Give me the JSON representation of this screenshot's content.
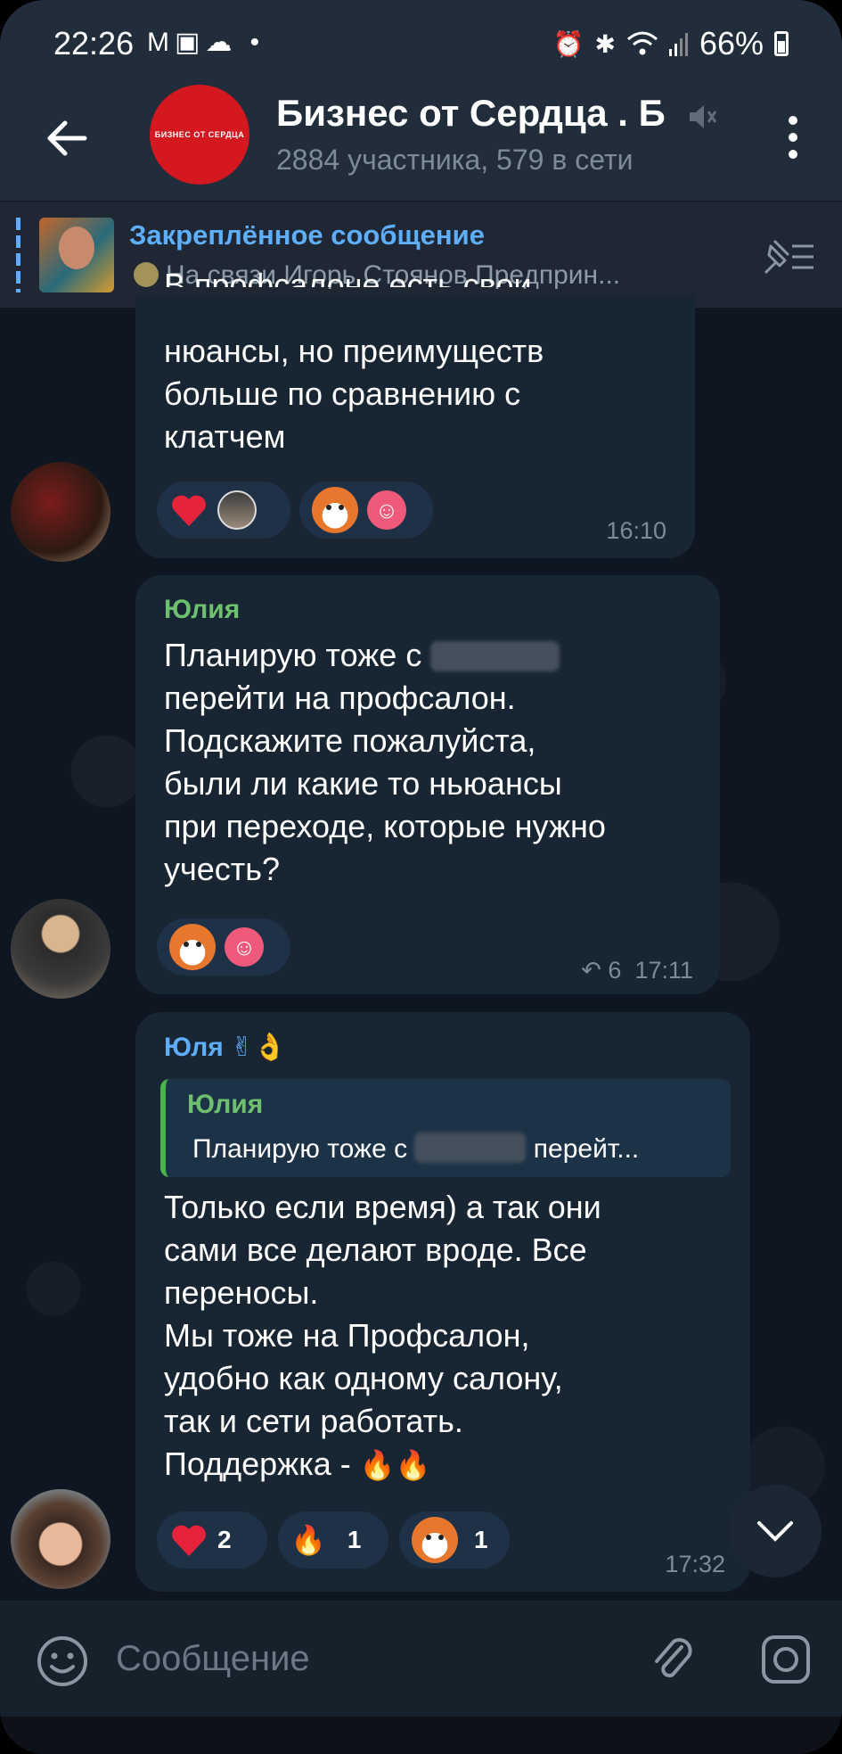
{
  "status": {
    "time": "22:26",
    "left_icons": "M▣☁ •",
    "battery": "66%",
    "icons": [
      "alarm-icon",
      "bluetooth-icon",
      "wifi-icon",
      "signal-icon",
      "battery-icon"
    ]
  },
  "header": {
    "title": "Бизнес от Сердца . Б",
    "subtitle": "2884 участника, 579 в сети",
    "avatar_text": "БИЗНЕС ОТ СЕРДЦА"
  },
  "pinned": {
    "title": "Закреплённое сообщение",
    "text": "На связи Игорь Стоянов  Предприн..."
  },
  "messages": [
    {
      "text": "нюансы, но преимуществ\nбольше по сравнению с\nклатчем",
      "partial_top": "В профсалоне есть свои",
      "time": "16:10"
    },
    {
      "sender": "Юлия",
      "text_before": "Планирую тоже с ",
      "text_after": "\nперейти на профсалон.\nПодскажите пожалуйста,\nбыли ли какие то ньюансы\nпри переходе, которые нужно\nучесть?",
      "replies": "6",
      "time": "17:11"
    },
    {
      "sender": "Юля",
      "sender_emoji": "✌👌",
      "reply_name": "Юлия",
      "reply_before": "Планирую тоже с ",
      "reply_after": " перейт...",
      "text": "Только если время) а так они\nсами все делают вроде. Все\nпереносы.\nМы тоже на Профсалон,\nудобно как одному салону,\nтак и сети работать.\nПоддержка - ",
      "text_emoji": "🔥🔥",
      "reactions": [
        {
          "icon": "heart-icon",
          "count": "2"
        },
        {
          "icon": "fire-icon",
          "count": "1"
        },
        {
          "icon": "fox-sticker-icon",
          "count": "1"
        }
      ],
      "time": "17:32"
    }
  ],
  "input": {
    "placeholder": "Сообщение"
  },
  "colors": {
    "accent": "#5eaefc",
    "bubble": "#182533",
    "background": "#0e1621",
    "header": "#212d3b",
    "sender_green": "#6ec06e",
    "sender_blue": "#5eaefc",
    "heart": "#e5233a"
  }
}
